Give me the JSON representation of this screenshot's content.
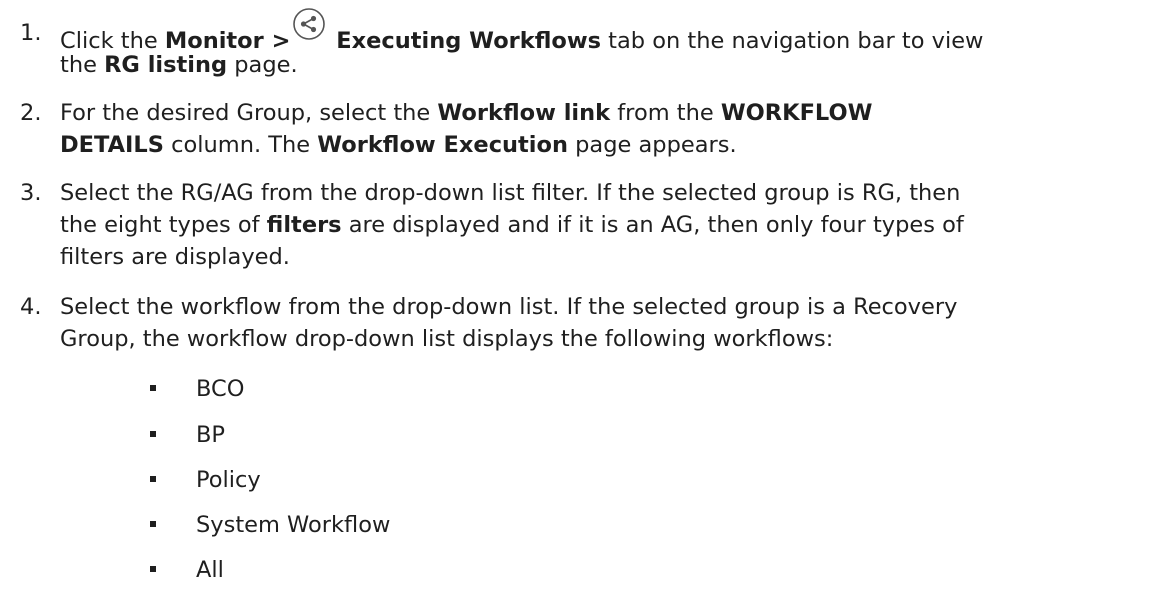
{
  "steps": [
    {
      "number": "1.",
      "lines": [
        [
          {
            "t": "Click the ",
            "b": false
          },
          {
            "t": "Monitor >",
            "b": true
          },
          {
            "icon": "workflow-share-icon"
          },
          {
            "t": " Executing Workflows",
            "b": true
          },
          {
            "t": " tab on the navigation bar to view",
            "b": false
          }
        ],
        [
          {
            "t": "the ",
            "b": false
          },
          {
            "t": "RG listing",
            "b": true
          },
          {
            "t": " page.",
            "b": false
          }
        ]
      ]
    },
    {
      "number": "2.",
      "lines": [
        [
          {
            "t": "For the desired Group, select the ",
            "b": false
          },
          {
            "t": "Workflow link",
            "b": true
          },
          {
            "t": " from the ",
            "b": false
          },
          {
            "t": "WORKFLOW",
            "b": true
          }
        ],
        [
          {
            "t": "DETAILS",
            "b": true
          },
          {
            "t": " column. The ",
            "b": false
          },
          {
            "t": "Workflow Execution",
            "b": true
          },
          {
            "t": " page appears.",
            "b": false
          }
        ]
      ]
    },
    {
      "number": "3.",
      "lines": [
        [
          {
            "t": "Select the RG/AG from the drop-down list filter. If the selected group is RG, then",
            "b": false
          }
        ],
        [
          {
            "t": "the eight types of ",
            "b": false
          },
          {
            "t": "filters",
            "b": true
          },
          {
            "t": " are displayed and if it is an AG, then only four types of",
            "b": false
          }
        ],
        [
          {
            "t": "filters are displayed.",
            "b": false
          }
        ]
      ]
    },
    {
      "number": "4.",
      "lines": [
        [
          {
            "t": "Select the workflow from the drop-down list. If the selected group is a Recovery",
            "b": false
          }
        ],
        [
          {
            "t": "Group, the workflow drop-down list displays the following workflows:",
            "b": false
          }
        ]
      ]
    }
  ],
  "workflow_options": [
    "BCO",
    "BP",
    "Policy",
    "System Workflow",
    "All"
  ]
}
